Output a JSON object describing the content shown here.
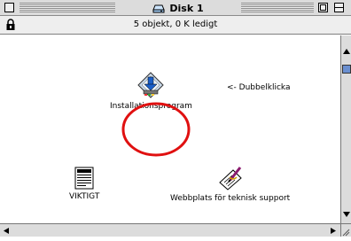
{
  "window": {
    "title": "Disk 1",
    "title_icon": "disk-icon"
  },
  "infobar": {
    "status": "5 objekt, 0 K ledigt",
    "lock_icon": "lock-icon"
  },
  "items": {
    "installer": {
      "label": "Installationsprogram",
      "icon": "installer-icon"
    },
    "hint": {
      "text": "<- Dubbelklicka"
    },
    "viktigt": {
      "label": "VIKTIGT",
      "icon": "document-icon"
    },
    "support": {
      "label": "Webbplats för teknisk support",
      "icon": "web-location-icon"
    }
  },
  "annotation": {
    "shape": "circle",
    "color": "#e01010"
  },
  "colors": {
    "scroll_thumb": "#6a8fd0",
    "chrome": "#dcdcdc",
    "highlight_circle": "#e01010"
  }
}
